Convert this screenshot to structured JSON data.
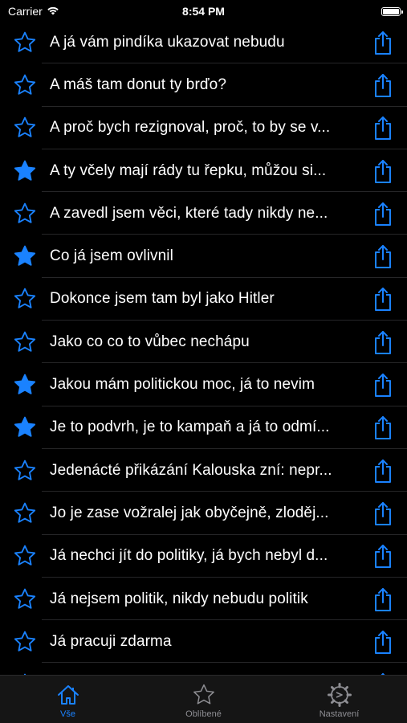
{
  "status_bar": {
    "carrier": "Carrier",
    "time": "8:54 PM"
  },
  "colors": {
    "accent": "#1a82ff",
    "background": "#000000",
    "tab_inactive": "#8e8e93"
  },
  "quotes": [
    {
      "text": "A já vám pindíka ukazovat nebudu",
      "favorite": false
    },
    {
      "text": "A máš tam donut ty brďo?",
      "favorite": false
    },
    {
      "text": "A proč bych rezignoval, proč, to by se v...",
      "favorite": false
    },
    {
      "text": "A ty včely mají rády tu řepku, můžou si...",
      "favorite": true
    },
    {
      "text": "A zavedl jsem věci, které tady nikdy ne...",
      "favorite": false
    },
    {
      "text": "Co já jsem ovlivnil",
      "favorite": true
    },
    {
      "text": "Dokonce jsem tam byl jako Hitler",
      "favorite": false
    },
    {
      "text": "Jako co co to vůbec nechápu",
      "favorite": false
    },
    {
      "text": "Jakou mám politickou moc, já to nevim",
      "favorite": true
    },
    {
      "text": "Je to podvrh, je to kampaň a já to odmí...",
      "favorite": true
    },
    {
      "text": "Jedenácté přikázání Kalouska zní: nepr...",
      "favorite": false
    },
    {
      "text": "Jo je zase vožralej jak obyčejně, zloděj...",
      "favorite": false
    },
    {
      "text": "Já nechci jít do politiky, já bych nebyl d...",
      "favorite": false
    },
    {
      "text": "Já nejsem politik, nikdy nebudu politik",
      "favorite": false
    },
    {
      "text": "Já pracuji zdarma",
      "favorite": false
    },
    {
      "text": "",
      "favorite": false
    }
  ],
  "icons": {
    "row_favorite": "star-icon",
    "row_share": "share-icon",
    "tab_all": "house-icon",
    "tab_favorites": "star-icon",
    "tab_settings": "gear-icon"
  },
  "tabs": [
    {
      "label": "Vše",
      "active": true
    },
    {
      "label": "Oblíbené",
      "active": false
    },
    {
      "label": "Nastavení",
      "active": false
    }
  ]
}
